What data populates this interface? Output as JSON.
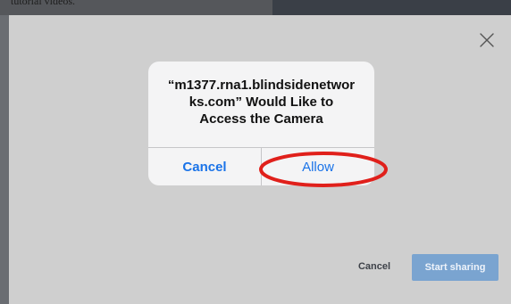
{
  "backdrop": {
    "top_text": "tutorial videos."
  },
  "dialog": {
    "close_icon": "close-icon",
    "footer": {
      "cancel_label": "Cancel",
      "start_label": "Start sharing"
    }
  },
  "permission_alert": {
    "title_lines": [
      "“m1377.rna1.blindsidenetwor",
      "ks.com” Would Like to",
      "Access the Camera"
    ],
    "cancel_label": "Cancel",
    "allow_label": "Allow"
  },
  "annotation": {
    "color": "#e0201b"
  },
  "colors": {
    "link_blue": "#1a73e8",
    "primary_button": "#7aa4d0",
    "overlay": "#cfcfcf"
  }
}
